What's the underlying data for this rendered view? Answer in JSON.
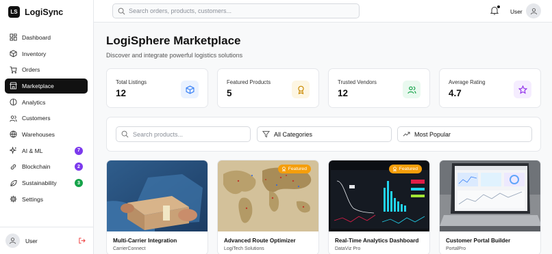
{
  "app": {
    "logo_text": "LS",
    "name": "LogiSync"
  },
  "sidebar": {
    "items": [
      {
        "label": "Dashboard",
        "icon": "dashboard-icon"
      },
      {
        "label": "Inventory",
        "icon": "box-icon"
      },
      {
        "label": "Orders",
        "icon": "cart-icon"
      },
      {
        "label": "Marketplace",
        "icon": "store-icon",
        "active": true
      },
      {
        "label": "Analytics",
        "icon": "chart-pie-icon"
      },
      {
        "label": "Customers",
        "icon": "users-icon"
      },
      {
        "label": "Warehouses",
        "icon": "warehouse-icon"
      },
      {
        "label": "AI & ML",
        "icon": "sparkles-icon",
        "badge": "7",
        "badge_color": "#7c3aed"
      },
      {
        "label": "Blockchain",
        "icon": "link-icon",
        "badge": "2",
        "badge_color": "#7c3aed"
      },
      {
        "label": "Sustainability",
        "icon": "leaf-icon",
        "badge": "3",
        "badge_color": "#16a34a"
      },
      {
        "label": "Settings",
        "icon": "gear-icon"
      }
    ],
    "footer_user": "User"
  },
  "header": {
    "search_placeholder": "Search orders, products, customers...",
    "user": "User"
  },
  "page": {
    "title": "LogiSphere Marketplace",
    "subtitle": "Discover and integrate powerful logistics solutions"
  },
  "stats": [
    {
      "label": "Total Listings",
      "value": "12",
      "icon": "cube-icon",
      "bg": "#eaf2ff",
      "color": "#3b82f6"
    },
    {
      "label": "Featured Products",
      "value": "5",
      "icon": "award-icon",
      "bg": "#fdf6e3",
      "color": "#ca8a04"
    },
    {
      "label": "Trusted Vendors",
      "value": "12",
      "icon": "users-icon",
      "bg": "#e9f9ef",
      "color": "#16a34a"
    },
    {
      "label": "Average Rating",
      "value": "4.7",
      "icon": "star-icon",
      "bg": "#f5edff",
      "color": "#9333ea"
    }
  ],
  "filters": {
    "search_placeholder": "Search products...",
    "category": "All Categories",
    "sort": "Most Popular"
  },
  "products": [
    {
      "title": "Multi-Carrier Integration",
      "vendor": "CarrierConnect",
      "featured": false
    },
    {
      "title": "Advanced Route Optimizer",
      "vendor": "LogiTech Solutions",
      "featured": true
    },
    {
      "title": "Real-Time Analytics Dashboard",
      "vendor": "DataViz Pro",
      "featured": true
    },
    {
      "title": "Customer Portal Builder",
      "vendor": "PortalPro",
      "featured": false
    }
  ],
  "featured_label": "Featured"
}
